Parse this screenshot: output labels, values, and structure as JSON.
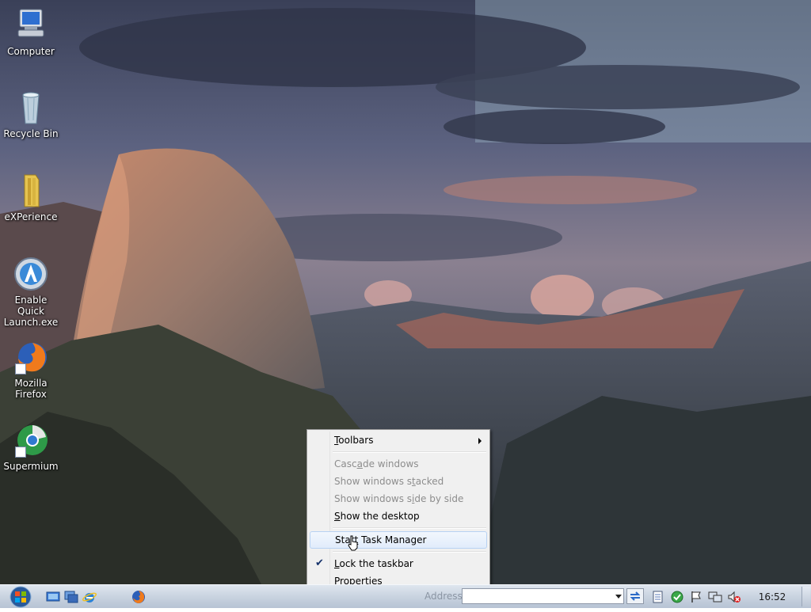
{
  "desktop_icons": [
    {
      "label": "Computer",
      "icon": "computer-icon"
    },
    {
      "label": "Recycle Bin",
      "icon": "recycle-bin-icon"
    },
    {
      "label": "eXPerience",
      "icon": "folder-icon"
    },
    {
      "label": "Enable Quick Launch.exe",
      "icon": "app-launcher-icon"
    },
    {
      "label": "Mozilla Firefox",
      "icon": "firefox-icon"
    },
    {
      "label": "Supermium",
      "icon": "supermium-icon"
    }
  ],
  "context_menu": {
    "toolbars": {
      "pre": "",
      "key": "T",
      "post": "oolbars"
    },
    "cascade": {
      "pre": "Casc",
      "key": "a",
      "post": "de windows"
    },
    "stacked": {
      "pre": "Show windows s",
      "key": "t",
      "post": "acked"
    },
    "side_by_side": {
      "pre": "Show windows s",
      "key": "i",
      "post": "de by side"
    },
    "show_desktop": {
      "pre": "",
      "key": "S",
      "post": "how the desktop"
    },
    "task_manager": {
      "pre": "Star",
      "key": "t",
      "post": " Task Manager"
    },
    "lock_taskbar": {
      "pre": "",
      "key": "L",
      "post": "ock the taskbar"
    },
    "properties": {
      "pre": "P",
      "key": "r",
      "post": "operties"
    },
    "check_glyph": "✔"
  },
  "taskbar": {
    "address_label": "Address",
    "address_value": "",
    "clock": "16:52"
  },
  "colors": {
    "taskbar": "#c9d3e0",
    "menu_bg": "#f0f0f0",
    "menu_highlight": "#e1ecfb"
  }
}
